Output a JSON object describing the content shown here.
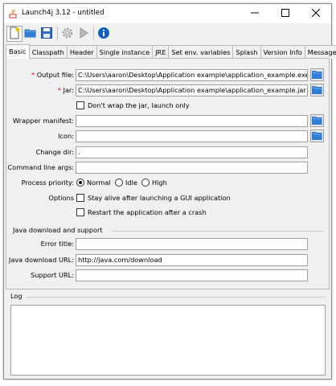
{
  "window": {
    "title": "Launch4j 3.12 - untitled"
  },
  "toolbar": {
    "buttons": [
      "new-icon",
      "open-icon",
      "save-icon",
      "build-gear-icon",
      "run-icon",
      "about-icon"
    ]
  },
  "tabs": [
    "Basic",
    "Classpath",
    "Header",
    "Single instance",
    "JRE",
    "Set env. variables",
    "Splash",
    "Version Info",
    "Messages"
  ],
  "basic": {
    "output_file": {
      "required": "*",
      "label": "Output file:",
      "value": "C:\\Users\\aaron\\Desktop\\Application example\\application_example.exe"
    },
    "jar": {
      "required": "*",
      "label": "Jar:",
      "value": "C:\\Users\\aaron\\Desktop\\Application example\\application_example.jar"
    },
    "dont_wrap": {
      "label": "Don't wrap the jar, launch only",
      "checked": false
    },
    "wrapper_manifest": {
      "label": "Wrapper manifest:",
      "value": ""
    },
    "icon": {
      "label": "Icon:",
      "value": ""
    },
    "change_dir": {
      "label": "Change dir:",
      "value": "."
    },
    "command_line_args": {
      "label": "Command line args:",
      "value": ""
    },
    "process_priority": {
      "label": "Process priority:",
      "options": [
        "Normal",
        "Idle",
        "High"
      ],
      "selected": "Normal"
    },
    "options": {
      "label": "Options",
      "stay_alive": "Stay alive after launching a GUI application",
      "restart": "Restart the application after a crash"
    },
    "java_download": {
      "title": "Java download and support",
      "error_title": {
        "label": "Error title:",
        "value": ""
      },
      "download_url": {
        "label": "Java download URL:",
        "value": "http://java.com/download"
      },
      "support_url": {
        "label": "Support URL:",
        "value": ""
      }
    }
  },
  "log": {
    "title": "Log",
    "content": ""
  },
  "colors": {
    "required_asterisk": "#d40000",
    "folder_icon": "#1f6fc9",
    "about_icon": "#1560bd"
  }
}
